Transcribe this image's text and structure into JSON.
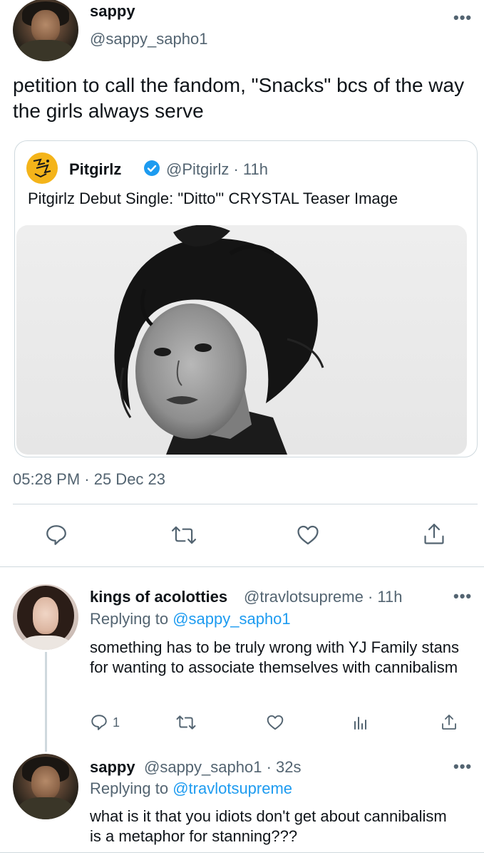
{
  "tweet": {
    "author_name": "sappy",
    "author_handle": "@sappy_sapho1",
    "text": "petition to call the fandom, \"Snacks\" bcs of the way the girls always serve",
    "timestamp": "05:28 PM · 25 Dec 23"
  },
  "quote": {
    "name": "Pitgirlz",
    "handle_time": "@Pitgirlz · 11h",
    "text": "Pitgirlz Debut Single: \"Ditto\"' CRYSTAL Teaser Image"
  },
  "replies": [
    {
      "name": "kings of acolotties",
      "meta": "@travlotsupreme · 11h",
      "replying_label": "Replying to",
      "replying_to": "@sappy_sapho1",
      "text": "something has to be truly wrong with YJ Family stans for wanting to associate themselves with cannibalism",
      "reply_count": "1"
    },
    {
      "name": "sappy",
      "meta": "@sappy_sapho1 · 32s",
      "replying_label": "Replying to",
      "replying_to": "@travlotsupreme",
      "text": "what is it that you idiots don't get about cannibalism is a metaphor for stanning???"
    }
  ],
  "more_glyph": "•••",
  "colors": {
    "accent": "#1d9bf0",
    "muted": "#536471",
    "border": "#cfd9de",
    "logo": "#f4b41a"
  },
  "icons": [
    "reply-icon",
    "retweet-icon",
    "like-icon",
    "share-icon",
    "analytics-icon",
    "verified-badge-icon",
    "more-icon"
  ]
}
